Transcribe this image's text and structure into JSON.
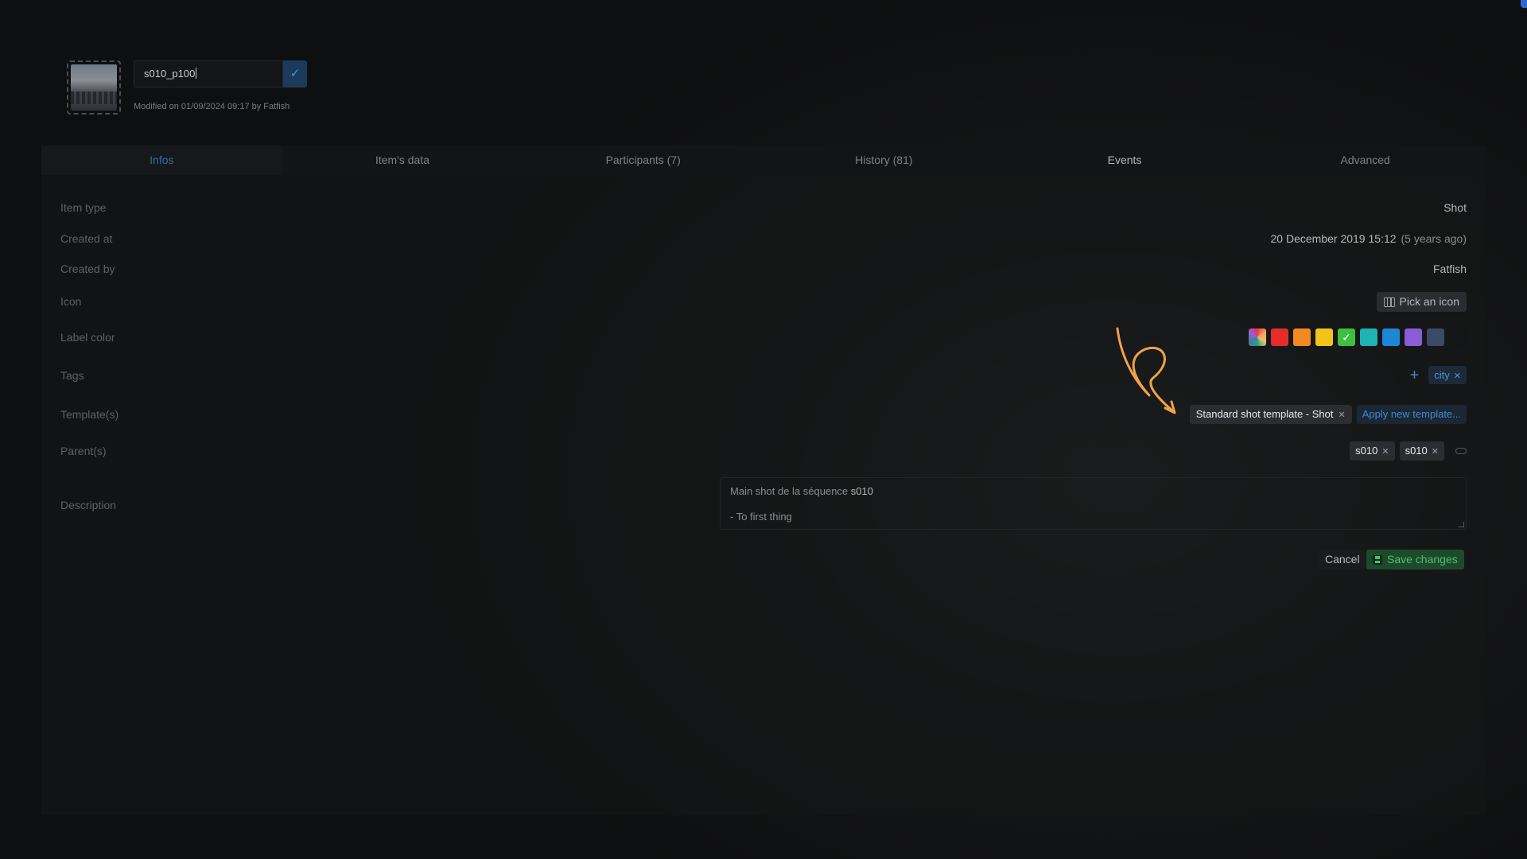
{
  "header": {
    "item_name": "s010_p100",
    "modified": "Modified on 01/09/2024 09:17 by Fatfish"
  },
  "tabs": [
    {
      "label": "Infos"
    },
    {
      "label": "Item's data"
    },
    {
      "label": "Participants (7)"
    },
    {
      "label": "History (81)"
    },
    {
      "label": "Events"
    },
    {
      "label": "Advanced"
    }
  ],
  "fields": {
    "item_type": {
      "label": "Item type",
      "value": "Shot"
    },
    "created_at": {
      "label": "Created at",
      "value": "20 December 2019 15:12",
      "relative": "(5 years ago)"
    },
    "created_by": {
      "label": "Created by",
      "value": "Fatfish"
    },
    "icon": {
      "label": "Icon",
      "button": "Pick an icon"
    },
    "label_color": {
      "label": "Label color"
    },
    "tags": {
      "label": "Tags",
      "items": [
        {
          "text": "city"
        }
      ]
    },
    "templates": {
      "label": "Template(s)",
      "items": [
        {
          "text": "Standard shot template - Shot"
        }
      ],
      "apply": "Apply new template..."
    },
    "parents": {
      "label": "Parent(s)",
      "items": [
        {
          "text": "s010"
        },
        {
          "text": "s010"
        }
      ]
    },
    "description": {
      "label": "Description",
      "line1_prefix": "Main shot de la séquence ",
      "line1_highlight": "s010",
      "line2": "- To first thing"
    }
  },
  "colors": {
    "swatches": [
      "#rainbow",
      "#e62b2b",
      "#f28a1f",
      "#f2c31a",
      "#3fbf3f",
      "#1fb3b3",
      "#1e86d6",
      "#8a5cd6",
      "#3b4b66",
      "#141516"
    ],
    "selected_index": 4,
    "accent": "#2f6ea8",
    "save_green": "#4fbf6d",
    "annotation": "#f0a24a"
  },
  "actions": {
    "cancel": "Cancel",
    "save": "Save changes"
  }
}
